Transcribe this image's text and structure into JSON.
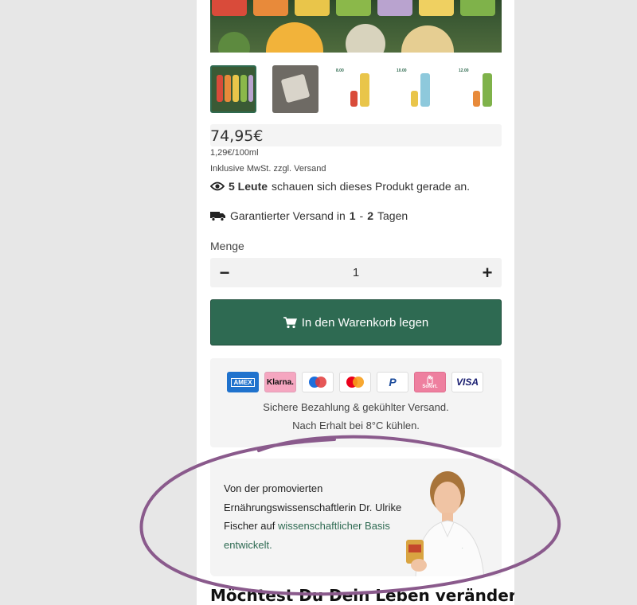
{
  "product": {
    "price": "74,95€",
    "unit_price": "1,29€/100ml",
    "vat_note": "Inklusive MwSt. zzgl. Versand",
    "viewers": {
      "count": "5 Leute",
      "text": "schauen sich dieses Produkt gerade an."
    },
    "shipping": {
      "prefix": "Garantierter Versand in",
      "from": "1",
      "sep": "-",
      "to": "2",
      "suffix": "Tagen"
    },
    "quantity_label": "Menge",
    "quantity_value": "1",
    "minus_label": "−",
    "plus_label": "+",
    "add_to_cart_label": "In den Warenkorb legen"
  },
  "thumbnails": [
    {
      "label": "",
      "active": true
    },
    {
      "label": "",
      "active": false
    },
    {
      "label": "8.00",
      "active": false
    },
    {
      "label": "10.00",
      "active": false
    },
    {
      "label": "12.00",
      "active": false
    }
  ],
  "payment": {
    "methods": [
      {
        "label": "AMEX",
        "bg": "#1f72cd",
        "fg": "#ffffff"
      },
      {
        "label": "Klarna.",
        "bg": "#f5a6c0",
        "fg": "#111111"
      },
      {
        "label": "maestro",
        "bg": "#ffffff",
        "fg": "#111111"
      },
      {
        "label": "mastercard",
        "bg": "#ffffff",
        "fg": "#111111"
      },
      {
        "label": "P",
        "bg": "#ffffff",
        "fg": "#1b4b9b"
      },
      {
        "label": "Sofort.",
        "bg": "#ee7f9f",
        "fg": "#ffffff"
      },
      {
        "label": "VISA",
        "bg": "#ffffff",
        "fg": "#1a1f71"
      }
    ],
    "line1": "Sichere Bezahlung & gekühlter Versand.",
    "line2": "Nach Erhalt bei 8°C kühlen."
  },
  "doctor": {
    "line1": "Von der promovierten",
    "line2": "Ernährungswissenschaftlerin Dr. Ulrike",
    "line3_plain": "Fischer auf",
    "line3_highlight": "wissenschaftlicher Basis",
    "line4_highlight": "entwickelt."
  },
  "teaser": "Möchtest Du Dein Leben verändern?",
  "colors": {
    "accent": "#2e6a52",
    "annotation": "#8a5a8c"
  }
}
